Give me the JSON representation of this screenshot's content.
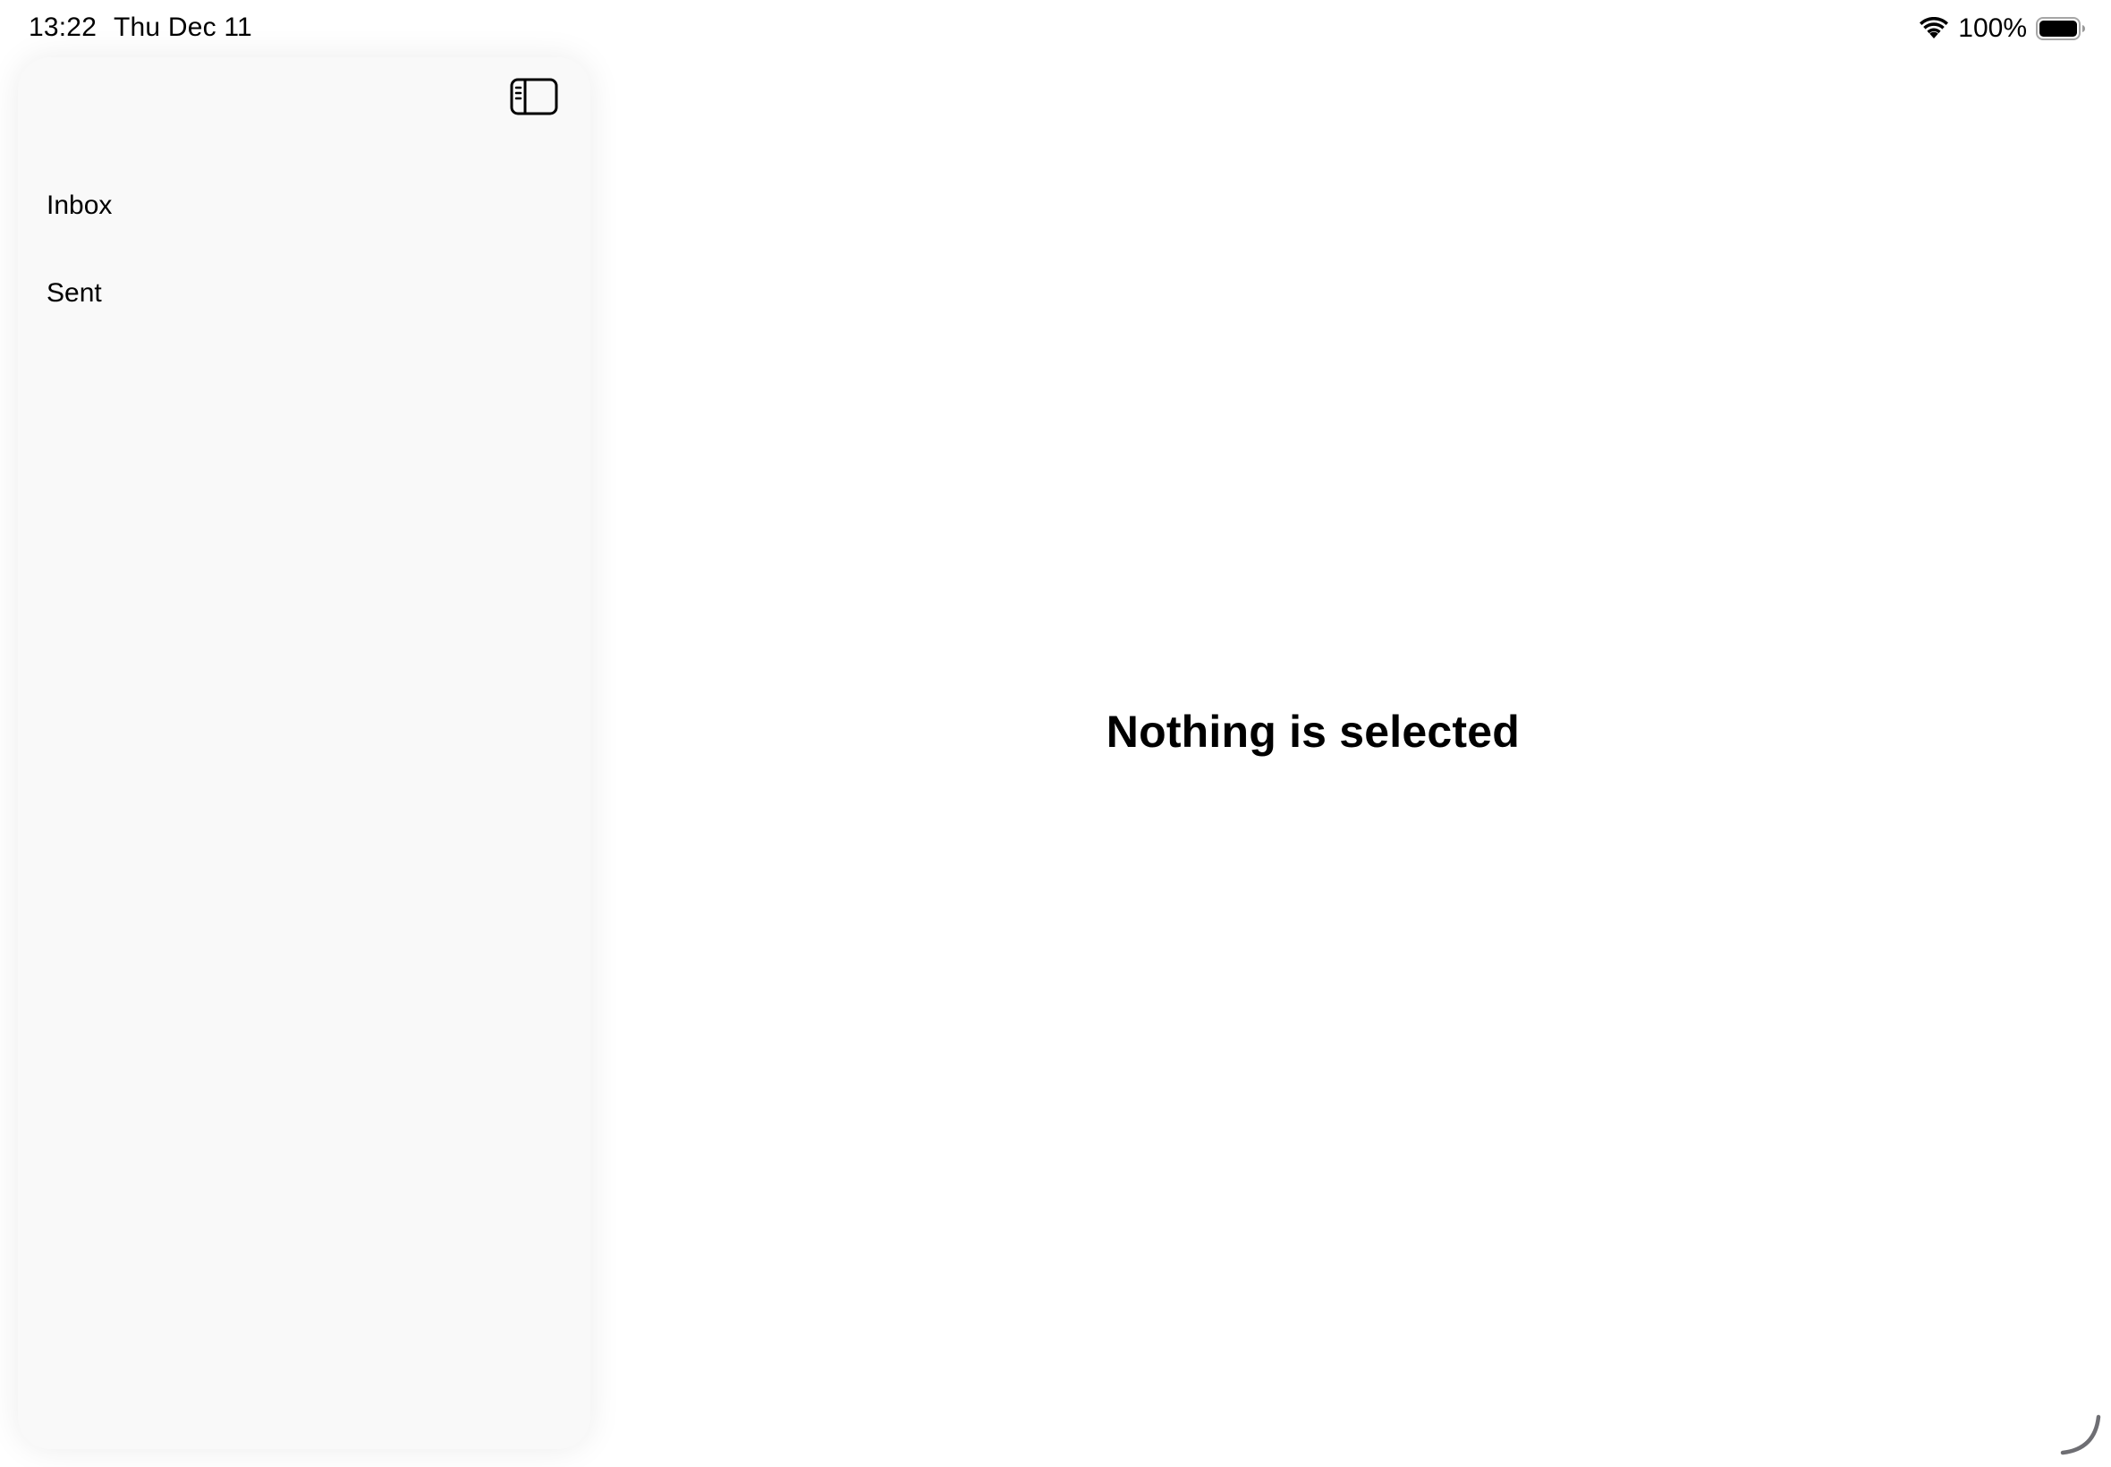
{
  "status_bar": {
    "time": "13:22",
    "date": "Thu Dec 11",
    "battery_percent": "100%",
    "battery_level": 1.0,
    "wifi_icon": "wifi-icon",
    "battery_icon": "battery-icon"
  },
  "sidebar": {
    "toggle_icon": "sidebar-toggle-icon",
    "items": [
      {
        "label": "Inbox"
      },
      {
        "label": "Sent"
      }
    ]
  },
  "detail": {
    "empty_message": "Nothing is selected"
  },
  "colors": {
    "sidebar_background": "#f9f9f9",
    "page_background": "#ffffff",
    "text": "#000000",
    "resize_handle": "#6e6e73"
  }
}
